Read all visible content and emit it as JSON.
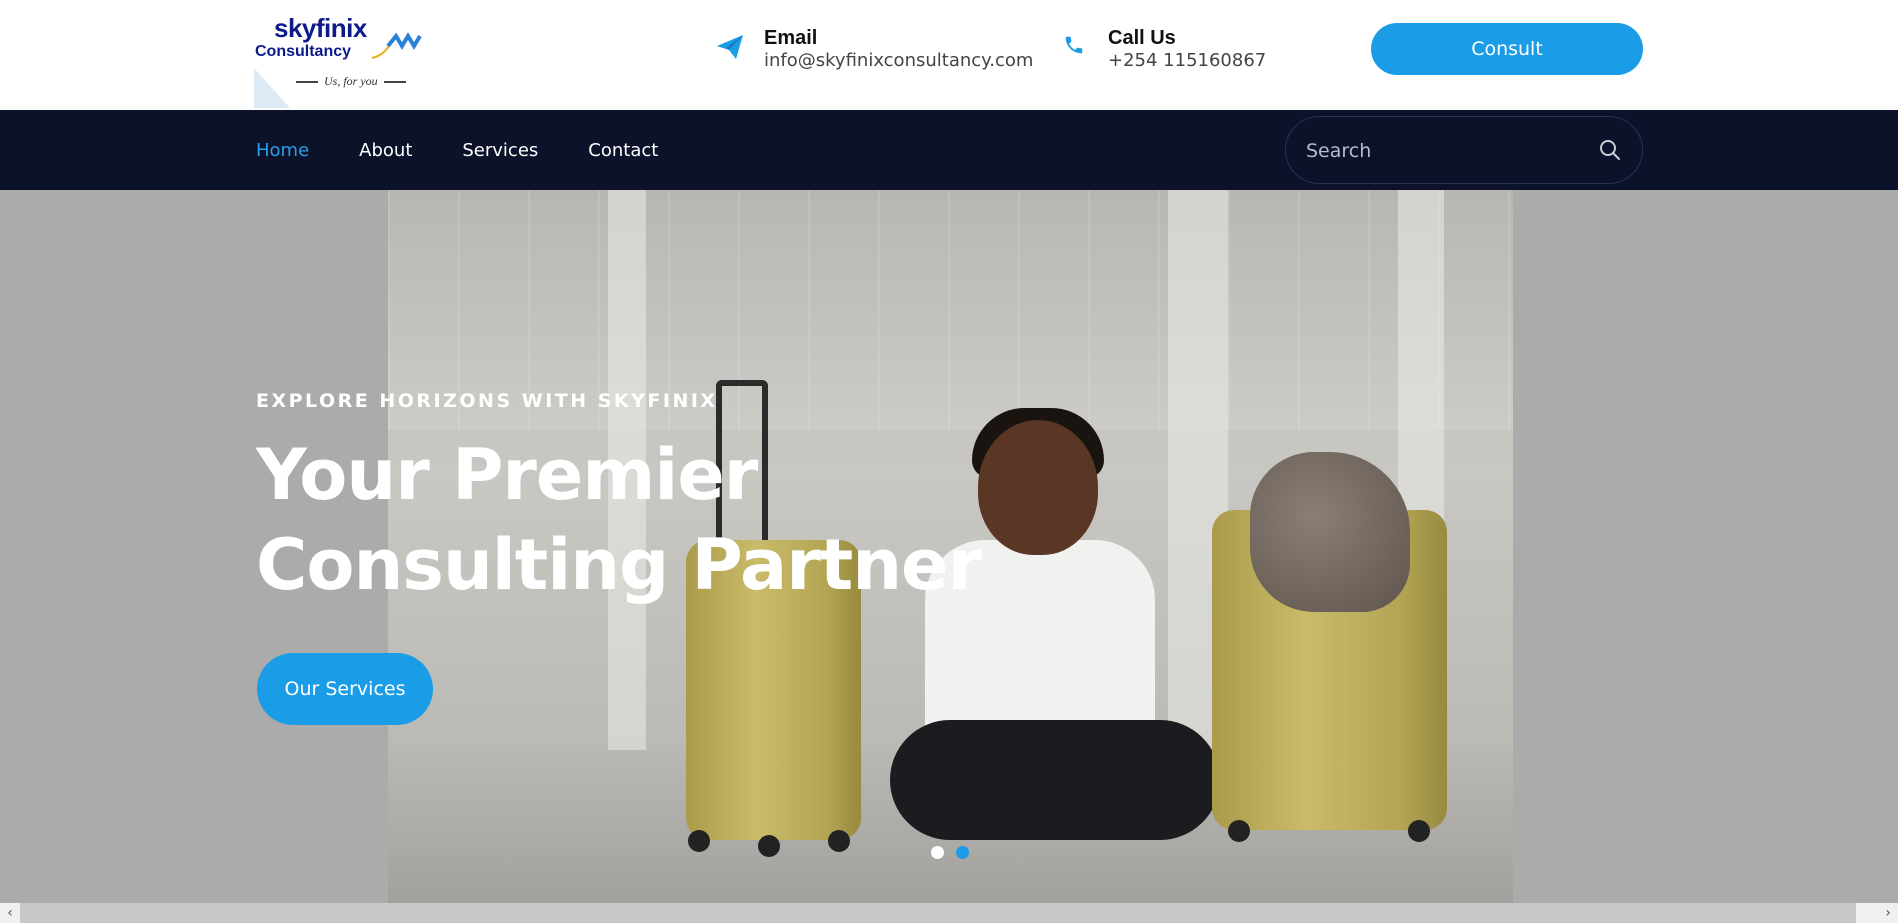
{
  "brand": {
    "name": "skyfinix",
    "sub": "Consultancy",
    "tagline": "Us, for you"
  },
  "header": {
    "email": {
      "label": "Email",
      "value": "info@skyfinixconsultancy.com",
      "icon": "paper-plane-icon"
    },
    "phone": {
      "label": "Call Us",
      "value": "+254 115160867",
      "icon": "phone-icon"
    },
    "cta_label": "Consult"
  },
  "nav": {
    "items": [
      {
        "label": "Home",
        "active": true
      },
      {
        "label": "About",
        "active": false
      },
      {
        "label": "Services",
        "active": false
      },
      {
        "label": "Contact",
        "active": false
      }
    ],
    "search_placeholder": "Search",
    "search_icon": "search-icon"
  },
  "hero": {
    "eyebrow": "EXPLORE HORIZONS WITH SKYFINIX",
    "headline_line1": "Your Premier",
    "headline_line2": "Consulting Partner",
    "button_label": "Our Services",
    "slides": 2,
    "active_slide": 2
  },
  "colors": {
    "accent": "#1a9ce6",
    "nav_bg": "#0c1229",
    "brand_navy": "#0d1a8a"
  },
  "scrollbar": {
    "left_arrow": "‹",
    "right_arrow": "›"
  }
}
